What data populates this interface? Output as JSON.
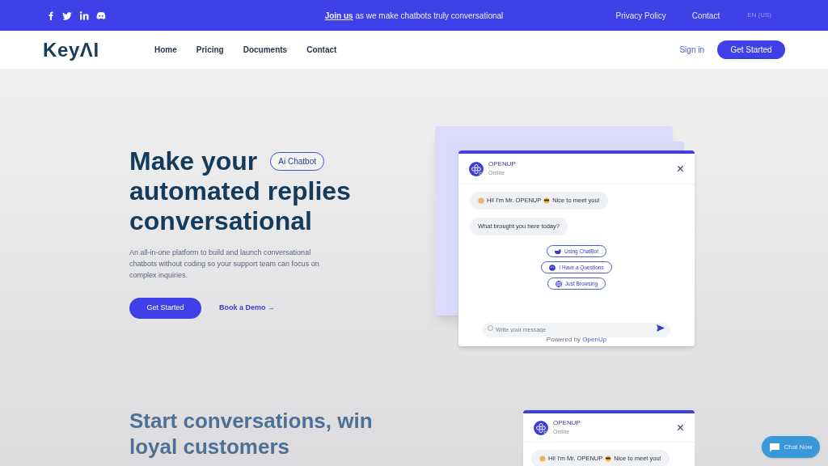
{
  "top_bar": {
    "socials": [
      {
        "kind": "facebook"
      },
      {
        "kind": "twitter"
      },
      {
        "kind": "linkedin"
      },
      {
        "kind": "discord"
      }
    ],
    "announcement": "**Join us** as we make chatbots truly conversational",
    "links": [
      "Privacy Policy",
      "Contact"
    ],
    "language": "EN (US)"
  },
  "nav": {
    "logo": "KeyΛI",
    "items": [
      "Home",
      "Pricing",
      "Documents",
      "Contact"
    ],
    "sign_in": "Sign in",
    "cta": "Get Started"
  },
  "hero": {
    "headline_lines": [
      "Make your",
      "automated replies",
      "conversational"
    ],
    "badge": "Ai Chatbot",
    "description": "An all-in-one platform to build and launch conversational chatbots without coding so your support team can focus on complex inquiries.",
    "primary": "Get Started",
    "secondary": "Book a Demo →"
  },
  "chat_widget": {
    "name": "OPENUP",
    "status": "Online",
    "close": "×",
    "messages": [
      {
        "parts": [
          "Hi! I'm Mr. OPENUP",
          "Nice to meet you!"
        ]
      },
      {
        "parts": [
          "What brought you here today?"
        ]
      }
    ],
    "options": [
      {
        "label": "Using ChatBot",
        "kind": "hand"
      },
      {
        "label": "I Have a Questions",
        "kind": "face"
      },
      {
        "label": "Just Browsing",
        "kind": "globe"
      }
    ],
    "input": {
      "placeholder": "Write your message"
    },
    "powered": "Powered by **OpenUp**"
  },
  "section2": {
    "headline_lines": [
      "Start conversations, win",
      "loyal customers"
    ],
    "chat_widget": {
      "name": "OPENUP",
      "status": "Online",
      "close": "×",
      "message_parts": [
        "Hi! I'm Mr. OPENUP",
        "Nice to meet you!"
      ]
    }
  },
  "chat_now": "Chat Now"
}
